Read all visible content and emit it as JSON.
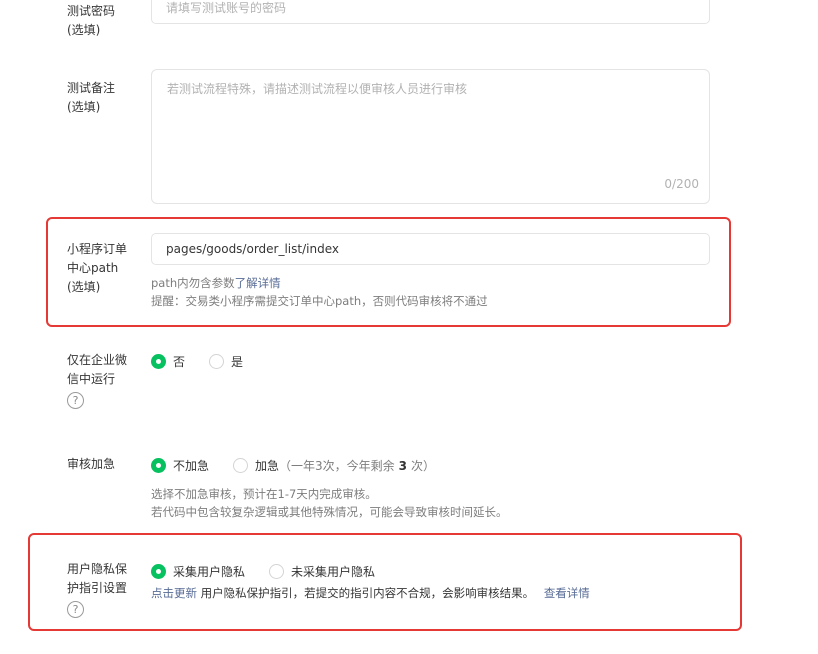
{
  "password": {
    "label_line1": "测试密码",
    "label_line2": "(选填)",
    "placeholder": "请填写测试账号的密码"
  },
  "notes": {
    "label_line1": "测试备注",
    "label_line2": "(选填)",
    "placeholder": "若测试流程特殊，请描述测试流程以便审核人员进行审核",
    "counter": "0/200"
  },
  "order_path": {
    "label_line1": "小程序订单",
    "label_line2": "中心path",
    "label_line3": "(选填)",
    "value": "pages/goods/order_list/index",
    "hint_prefix": "path内勿含参数",
    "hint_link": "了解详情",
    "hint2": "提醒：交易类小程序需提交订单中心path，否则代码审核将不通过"
  },
  "wecom_only": {
    "label_line1": "仅在企业微",
    "label_line2": "信中运行",
    "help_icon": "?",
    "option_no": "否",
    "option_yes": "是"
  },
  "expedite": {
    "label": "审核加急",
    "option_no": "不加急",
    "option_yes": "加急",
    "quota_prefix": "（一年3次，今年剩余",
    "quota_count": "3",
    "quota_suffix": "次）",
    "hint1": "选择不加急审核，预计在1-7天内完成审核。",
    "hint2": "若代码中包含较复杂逻辑或其他特殊情况，可能会导致审核时间延长。"
  },
  "privacy": {
    "label_line1": "用户隐私保",
    "label_line2": "护指引设置",
    "help_icon": "?",
    "option_collect": "采集用户隐私",
    "option_not_collect": "未采集用户隐私",
    "update_link": "点击更新",
    "hint_text": " 用户隐私保护指引，若提交的指引内容不合规，会影响审核结果。",
    "detail_link": "查看详情"
  },
  "colors": {
    "accent_green": "#07c160",
    "highlight_red": "#e53935",
    "link_blue": "#576b95"
  }
}
